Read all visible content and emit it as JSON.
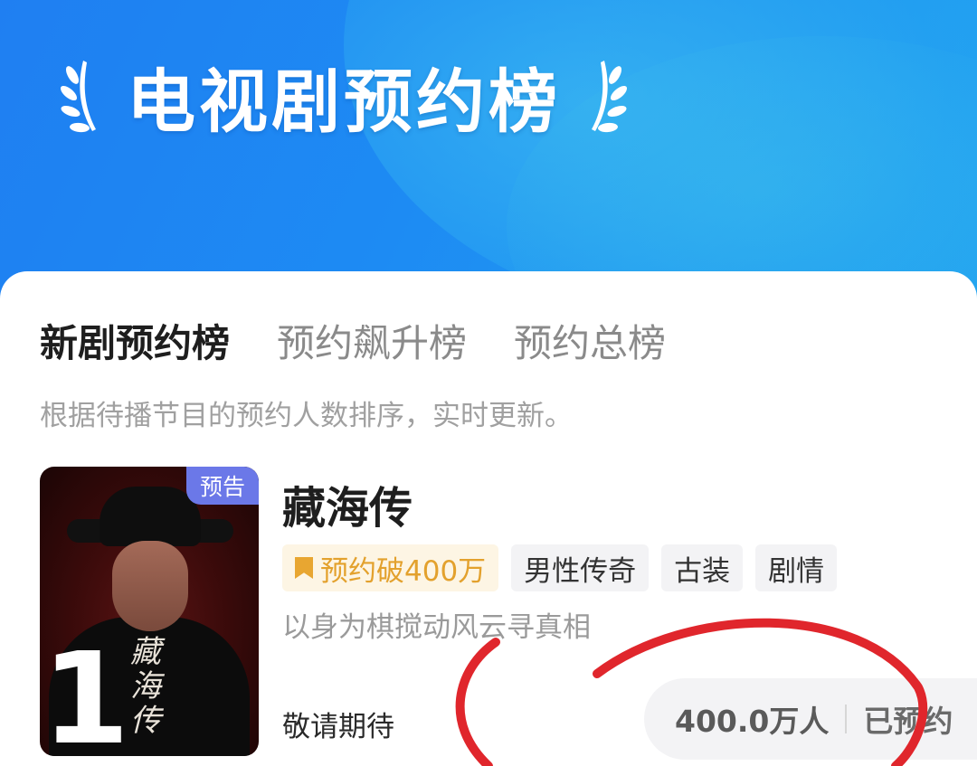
{
  "header": {
    "title": "电视剧预约榜"
  },
  "tabs": [
    {
      "label": "新剧预约榜",
      "active": true
    },
    {
      "label": "预约飙升榜",
      "active": false
    },
    {
      "label": "预约总榜",
      "active": false
    }
  ],
  "description": "根据待播节目的预约人数排序，实时更新。",
  "items": [
    {
      "rank": "1",
      "badge": "预告",
      "poster_title": "藏海传",
      "title": "藏海传",
      "tags": [
        {
          "label": "预约破400万",
          "icon": "bookmark-icon"
        },
        {
          "label": "男性传奇"
        },
        {
          "label": "古装"
        },
        {
          "label": "剧情"
        }
      ],
      "synopsis": "以身为棋搅动风云寻真相",
      "status": "敬请期待",
      "reserve_count": "400.0万人",
      "reserve_label": "已预约"
    }
  ],
  "colors": {
    "header_blue": "#1f7ff2",
    "tag_hot": "#e3a12d",
    "badge": "#6b78e8",
    "annotation_red": "#e0262c"
  }
}
